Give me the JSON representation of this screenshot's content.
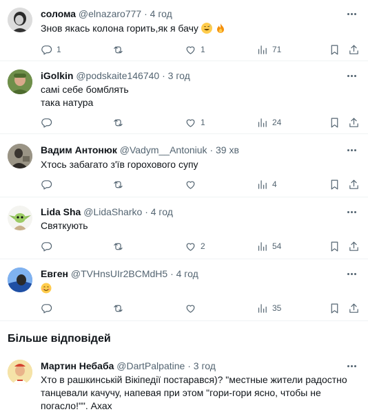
{
  "replies": [
    {
      "name": "солома",
      "handle": "@elnazaro777",
      "time": "4 год",
      "lines": [
        "Знов якась колона горить,як я бачу"
      ],
      "emojis": [
        "grinning-face-with-sweat",
        "fire"
      ],
      "replies": "1",
      "retweets": "",
      "likes": "1",
      "views": "71"
    },
    {
      "name": "iGolkin",
      "handle": "@podskaite146740",
      "time": "3 год",
      "lines": [
        "самі себе бомблять",
        "така натура"
      ],
      "replies": "",
      "retweets": "",
      "likes": "1",
      "views": "24"
    },
    {
      "name": "Вадим Антонюк",
      "handle": "@Vadym__Antoniuk",
      "time": "39 хв",
      "lines": [
        "Хтось забагато з'їв горохового супу"
      ],
      "replies": "",
      "retweets": "",
      "likes": "",
      "views": "4"
    },
    {
      "name": "Lida Sha",
      "handle": "@LidaSharko",
      "time": "4 год",
      "lines": [
        "Святкують"
      ],
      "replies": "",
      "retweets": "",
      "likes": "2",
      "views": "54"
    },
    {
      "name": "Евген",
      "handle": "@TVHnsUIr2BCMdH5",
      "time": "4 год",
      "lines": [
        ""
      ],
      "emojis": [
        "smiling-face"
      ],
      "replies": "",
      "retweets": "",
      "likes": "",
      "views": "35"
    }
  ],
  "more_replies_title": "Більше відповідей",
  "more_reply": {
    "name": "Мартин Небаба",
    "handle": "@DartPalpatine",
    "time": "3 год",
    "lines": [
      "Хто в рашкинській Вікіпедії постарався)? \"местные жители радостно",
      "танцевали качучу, напевая при этом \"гори-гори ясно, чтобы не",
      "погасло!\"\". Ахах"
    ]
  },
  "separator": "·",
  "colors": {
    "text": "#0f1419",
    "secondary": "#536471",
    "divider": "#eff3f4"
  }
}
